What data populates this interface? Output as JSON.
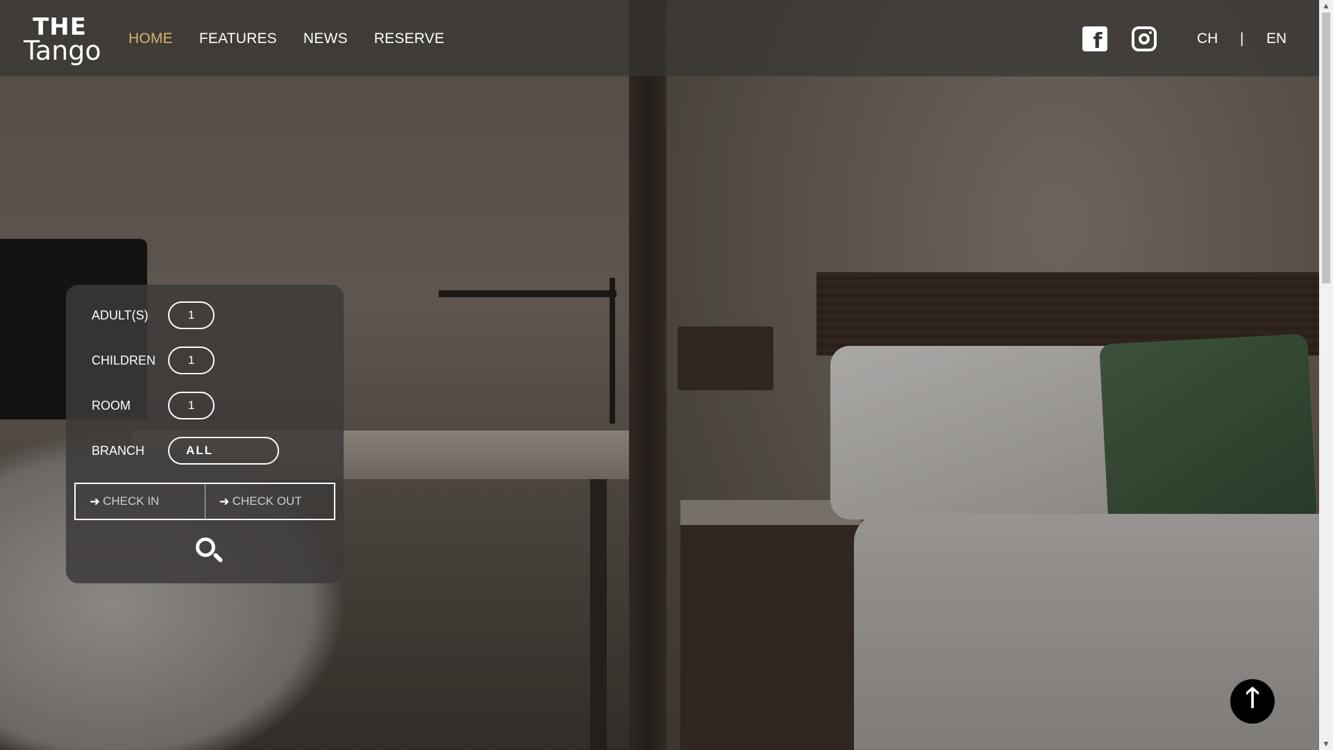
{
  "logo": {
    "line1": "THE",
    "line2": "Tango"
  },
  "nav": {
    "home": "HOME",
    "features": "FEATURES",
    "news": "NEWS",
    "reserve": "RESERVE"
  },
  "social": {
    "facebook_icon": "facebook-icon",
    "instagram_icon": "instagram-icon",
    "facebook_glyph": "f"
  },
  "lang": {
    "ch": "CH",
    "sep": "|",
    "en": "EN"
  },
  "booking": {
    "adults_label": "ADULT(S)",
    "adults_value": "1",
    "children_label": "CHILDREN",
    "children_value": "1",
    "room_label": "ROOM",
    "room_value": "1",
    "branch_label": "BRANCH",
    "branch_value": "ALL",
    "checkin_label": "CHECK IN",
    "checkout_label": "CHECK OUT",
    "arrow_glyph": "➜"
  },
  "back_to_top_glyph": "🡑",
  "colors": {
    "accent": "#d9b46a",
    "header_bg": "#373432",
    "panel_bg": "#3c3a39"
  }
}
